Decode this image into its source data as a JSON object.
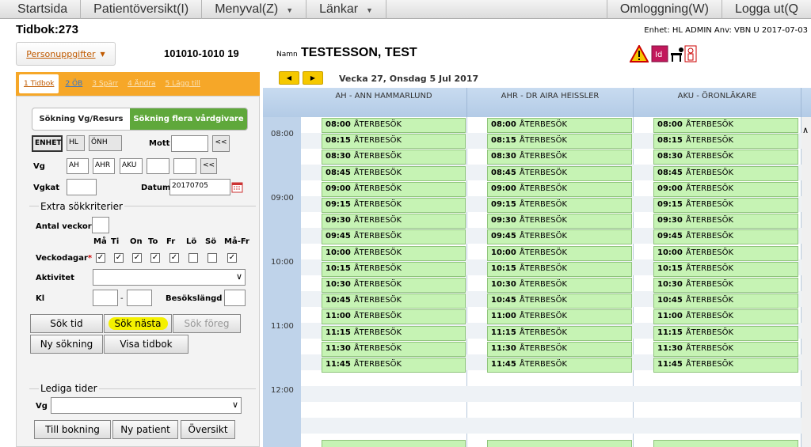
{
  "menu": [
    "Startsida",
    "Patientöversikt(I)",
    "Menyval(Z)",
    "Länkar",
    "Omloggning(W)",
    "Logga ut(Q"
  ],
  "tidbok": "Tidbok:273",
  "enhet_info": "Enhet: HL ADMIN Anv: VBN  U  2017-07-03",
  "personuppgifter": "Personuppgifter",
  "pnr": "101010-1010 19",
  "namn_label": "Namn",
  "namn": "TESTESSON, TEST",
  "tabs": [
    "1 Tidbok",
    "2 ÖB",
    "3 Spärr",
    "4 Ändra",
    "5 Lägg till"
  ],
  "seg": [
    "Sökning Vg/Resurs",
    "Sökning flera vårdgivare"
  ],
  "form": {
    "enhet": "ENHET",
    "hl": "HL",
    "onh": "ÖNH",
    "mott": "Mott",
    "vg": "Vg",
    "vg1": "AH",
    "vg2": "AHR",
    "vg3": "AKU",
    "vgkat": "Vgkat",
    "datum": "Datum",
    "datum_val": "20170705",
    "arrow": "<<"
  },
  "extra": {
    "title": "Extra sökkriterier",
    "antal": "Antal veckor",
    "days": [
      "Må",
      "Ti",
      "On",
      "To",
      "Fr",
      "Lö",
      "Sö",
      "Må-Fr"
    ],
    "checks": [
      true,
      true,
      true,
      true,
      true,
      false,
      false,
      true
    ],
    "veckodagar": "Veckodagar",
    "aktivitet": "Aktivitet",
    "kl": "Kl",
    "dash": "-",
    "besok": "Besökslängd"
  },
  "buttons": {
    "sok_tid": "Sök tid",
    "sok_nasta": "Sök nästa",
    "sok_foreg": "Sök föreg",
    "ny_sokning": "Ny sökning",
    "visa_tidbok": "Visa tidbok"
  },
  "lediga": {
    "title": "Lediga tider",
    "vg": "Vg",
    "till_bokning": "Till bokning",
    "ny_patient": "Ny patient",
    "oversikt": "Översikt"
  },
  "week": "Vecka 27, Onsdag 5 Jul 2017",
  "columns": [
    "AH - ANN HAMMARLUND",
    "AHR - DR AIRA HEISSLER",
    "AKU - ÖRONLÄKARE"
  ],
  "hours": [
    "08:00",
    "09:00",
    "10:00",
    "11:00",
    "12:00"
  ],
  "slots": [
    "08:00",
    "08:15",
    "08:30",
    "08:45",
    "09:00",
    "09:15",
    "09:30",
    "09:45",
    "10:00",
    "10:15",
    "10:30",
    "10:45",
    "11:00",
    "11:15",
    "11:30",
    "11:45"
  ],
  "slot_text": "ÅTERBESÖK",
  "colors": {
    "slot": "#c6f3b4",
    "tab": "#f6a728",
    "green": "#5fa83b",
    "header": "#bfd3ea"
  }
}
